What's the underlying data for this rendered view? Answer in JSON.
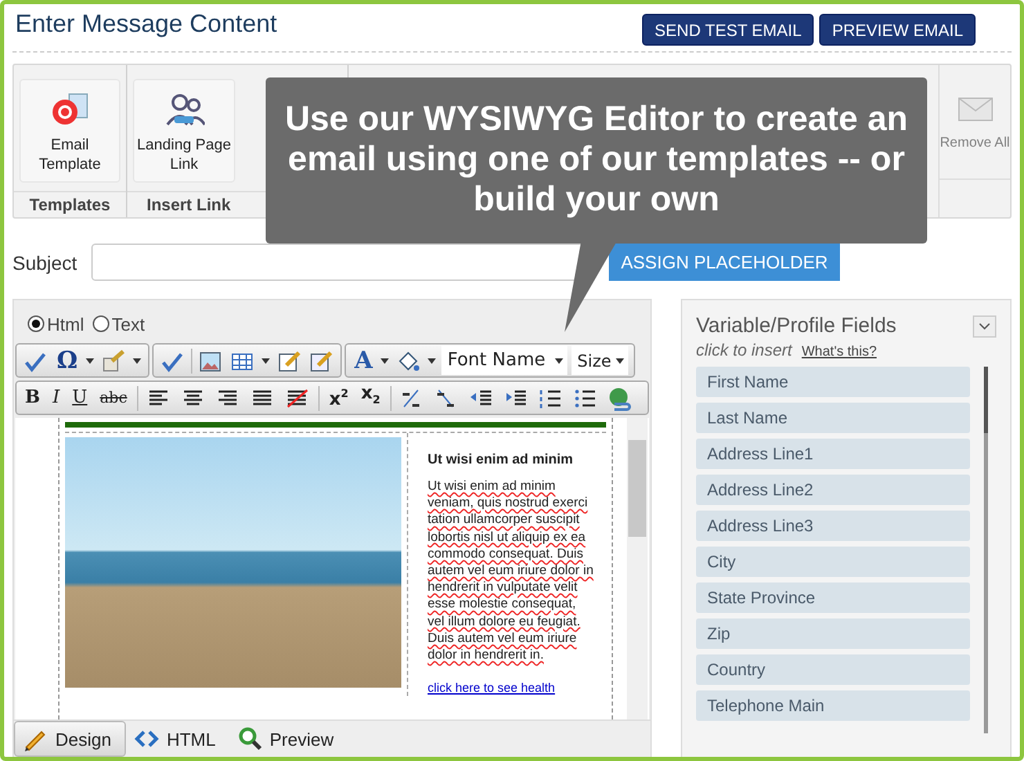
{
  "header": {
    "title": "Enter Message Content",
    "buttons": [
      "SEND TEST EMAIL",
      "PREVIEW EMAIL"
    ]
  },
  "ribbon": {
    "groups": [
      {
        "label": "Templates",
        "items": [
          {
            "label": "Email Template",
            "disabled": false
          }
        ]
      },
      {
        "label": "Insert Link",
        "items": [
          {
            "label": "Landing Page Link",
            "disabled": false
          }
        ]
      },
      {
        "items": [
          {
            "label": "Remove All",
            "disabled": true
          }
        ]
      }
    ]
  },
  "tooltip": {
    "text": "Use our WYSIWYG Editor to create an email using one of our templates -- or build your own"
  },
  "subject": {
    "label": "Subject",
    "button": "ASSIGN PLACEHOLDER"
  },
  "editor": {
    "modes": [
      {
        "label": "Html",
        "selected": true
      },
      {
        "label": "Text",
        "selected": false
      }
    ],
    "symbol_button": "Ω",
    "font_color_button": "A",
    "font_name": "Font Name",
    "size": "Size",
    "format_buttons": [
      "B",
      "I",
      "U",
      "abc"
    ],
    "script_buttons": [
      "x$^{2}$",
      "x$_{2}$"
    ],
    "content": {
      "heading": "Ut wisi enim ad minim",
      "body": "Ut wisi enim ad minim veniam, quis nostrud exerci tation ullamcorper suscipit lobortis nisl ut aliquip ex ea commodo consequat. Duis autem vel eum iriure dolor in hendrerit in vulputate velit esse molestie consequat, vel illum dolore eu feugiat. Duis autem vel eum iriure dolor in hendrerit in.",
      "link": "click here to see health"
    },
    "tabs": [
      {
        "label": "Design",
        "selected": true
      },
      {
        "label": "HTML",
        "selected": false
      },
      {
        "label": "Preview",
        "selected": false
      }
    ]
  },
  "fields_panel": {
    "title": "Variable/Profile Fields",
    "hint": "click to insert",
    "help_link": "What's this?",
    "items": [
      "First Name",
      "Last Name",
      "Address Line1",
      "Address Line2",
      "Address Line3",
      "City",
      "State Province",
      "Zip",
      "Country",
      "Telephone Main"
    ]
  }
}
